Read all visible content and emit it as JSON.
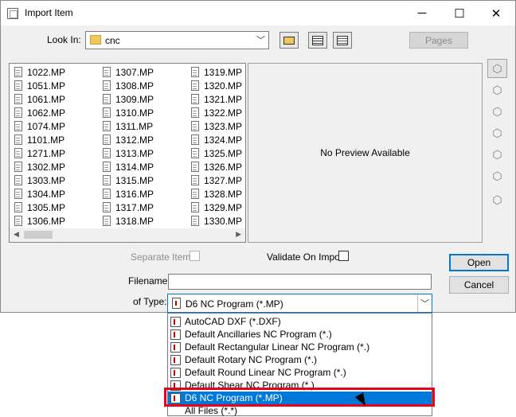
{
  "window": {
    "title": "Import Item",
    "controls": {
      "minimize": "─",
      "maximize": "☐",
      "close": "✕"
    }
  },
  "lookin": {
    "label": "Look In:",
    "value": "cnc"
  },
  "toolbar": {
    "pages_label": "Pages",
    "icons": [
      "folder-up-icon",
      "list-view-icon",
      "details-view-icon"
    ]
  },
  "files": {
    "col1": [
      "1022.MP",
      "1051.MP",
      "1061.MP",
      "1062.MP",
      "1074.MP",
      "1101.MP",
      "1271.MP",
      "1302.MP",
      "1303.MP",
      "1304.MP",
      "1305.MP",
      "1306.MP"
    ],
    "col2": [
      "1307.MP",
      "1308.MP",
      "1309.MP",
      "1310.MP",
      "1311.MP",
      "1312.MP",
      "1313.MP",
      "1314.MP",
      "1315.MP",
      "1316.MP",
      "1317.MP",
      "1318.MP"
    ],
    "col3": [
      "1319.MP",
      "1320.MP",
      "1321.MP",
      "1322.MP",
      "1323.MP",
      "1324.MP",
      "1325.MP",
      "1326.MP",
      "1327.MP",
      "1328.MP",
      "1329.MP",
      "1330.MP"
    ]
  },
  "preview": {
    "text": "No Preview Available"
  },
  "options": {
    "separate_items": "Separate Items",
    "validate_on_import": "Validate On Import"
  },
  "buttons": {
    "open": "Open",
    "cancel": "Cancel"
  },
  "filename": {
    "label": "Filename:",
    "value": ""
  },
  "filetype": {
    "label": "of Type:",
    "value": "D6 NC Program (*.MP)",
    "options": [
      "AutoCAD DXF (*.DXF)",
      "Default Ancillaries NC Program (*.)",
      "Default Rectangular Linear NC Program (*.)",
      "Default Rotary NC Program (*.)",
      "Default Round Linear NC Program (*.)",
      "Default Shear NC Program (*.)",
      "D6 NC Program (*.MP)",
      "All Files (*.*)"
    ],
    "selected_index": 6
  },
  "colors": {
    "accent": "#0078d7",
    "highlight_box": "#e8001c"
  }
}
